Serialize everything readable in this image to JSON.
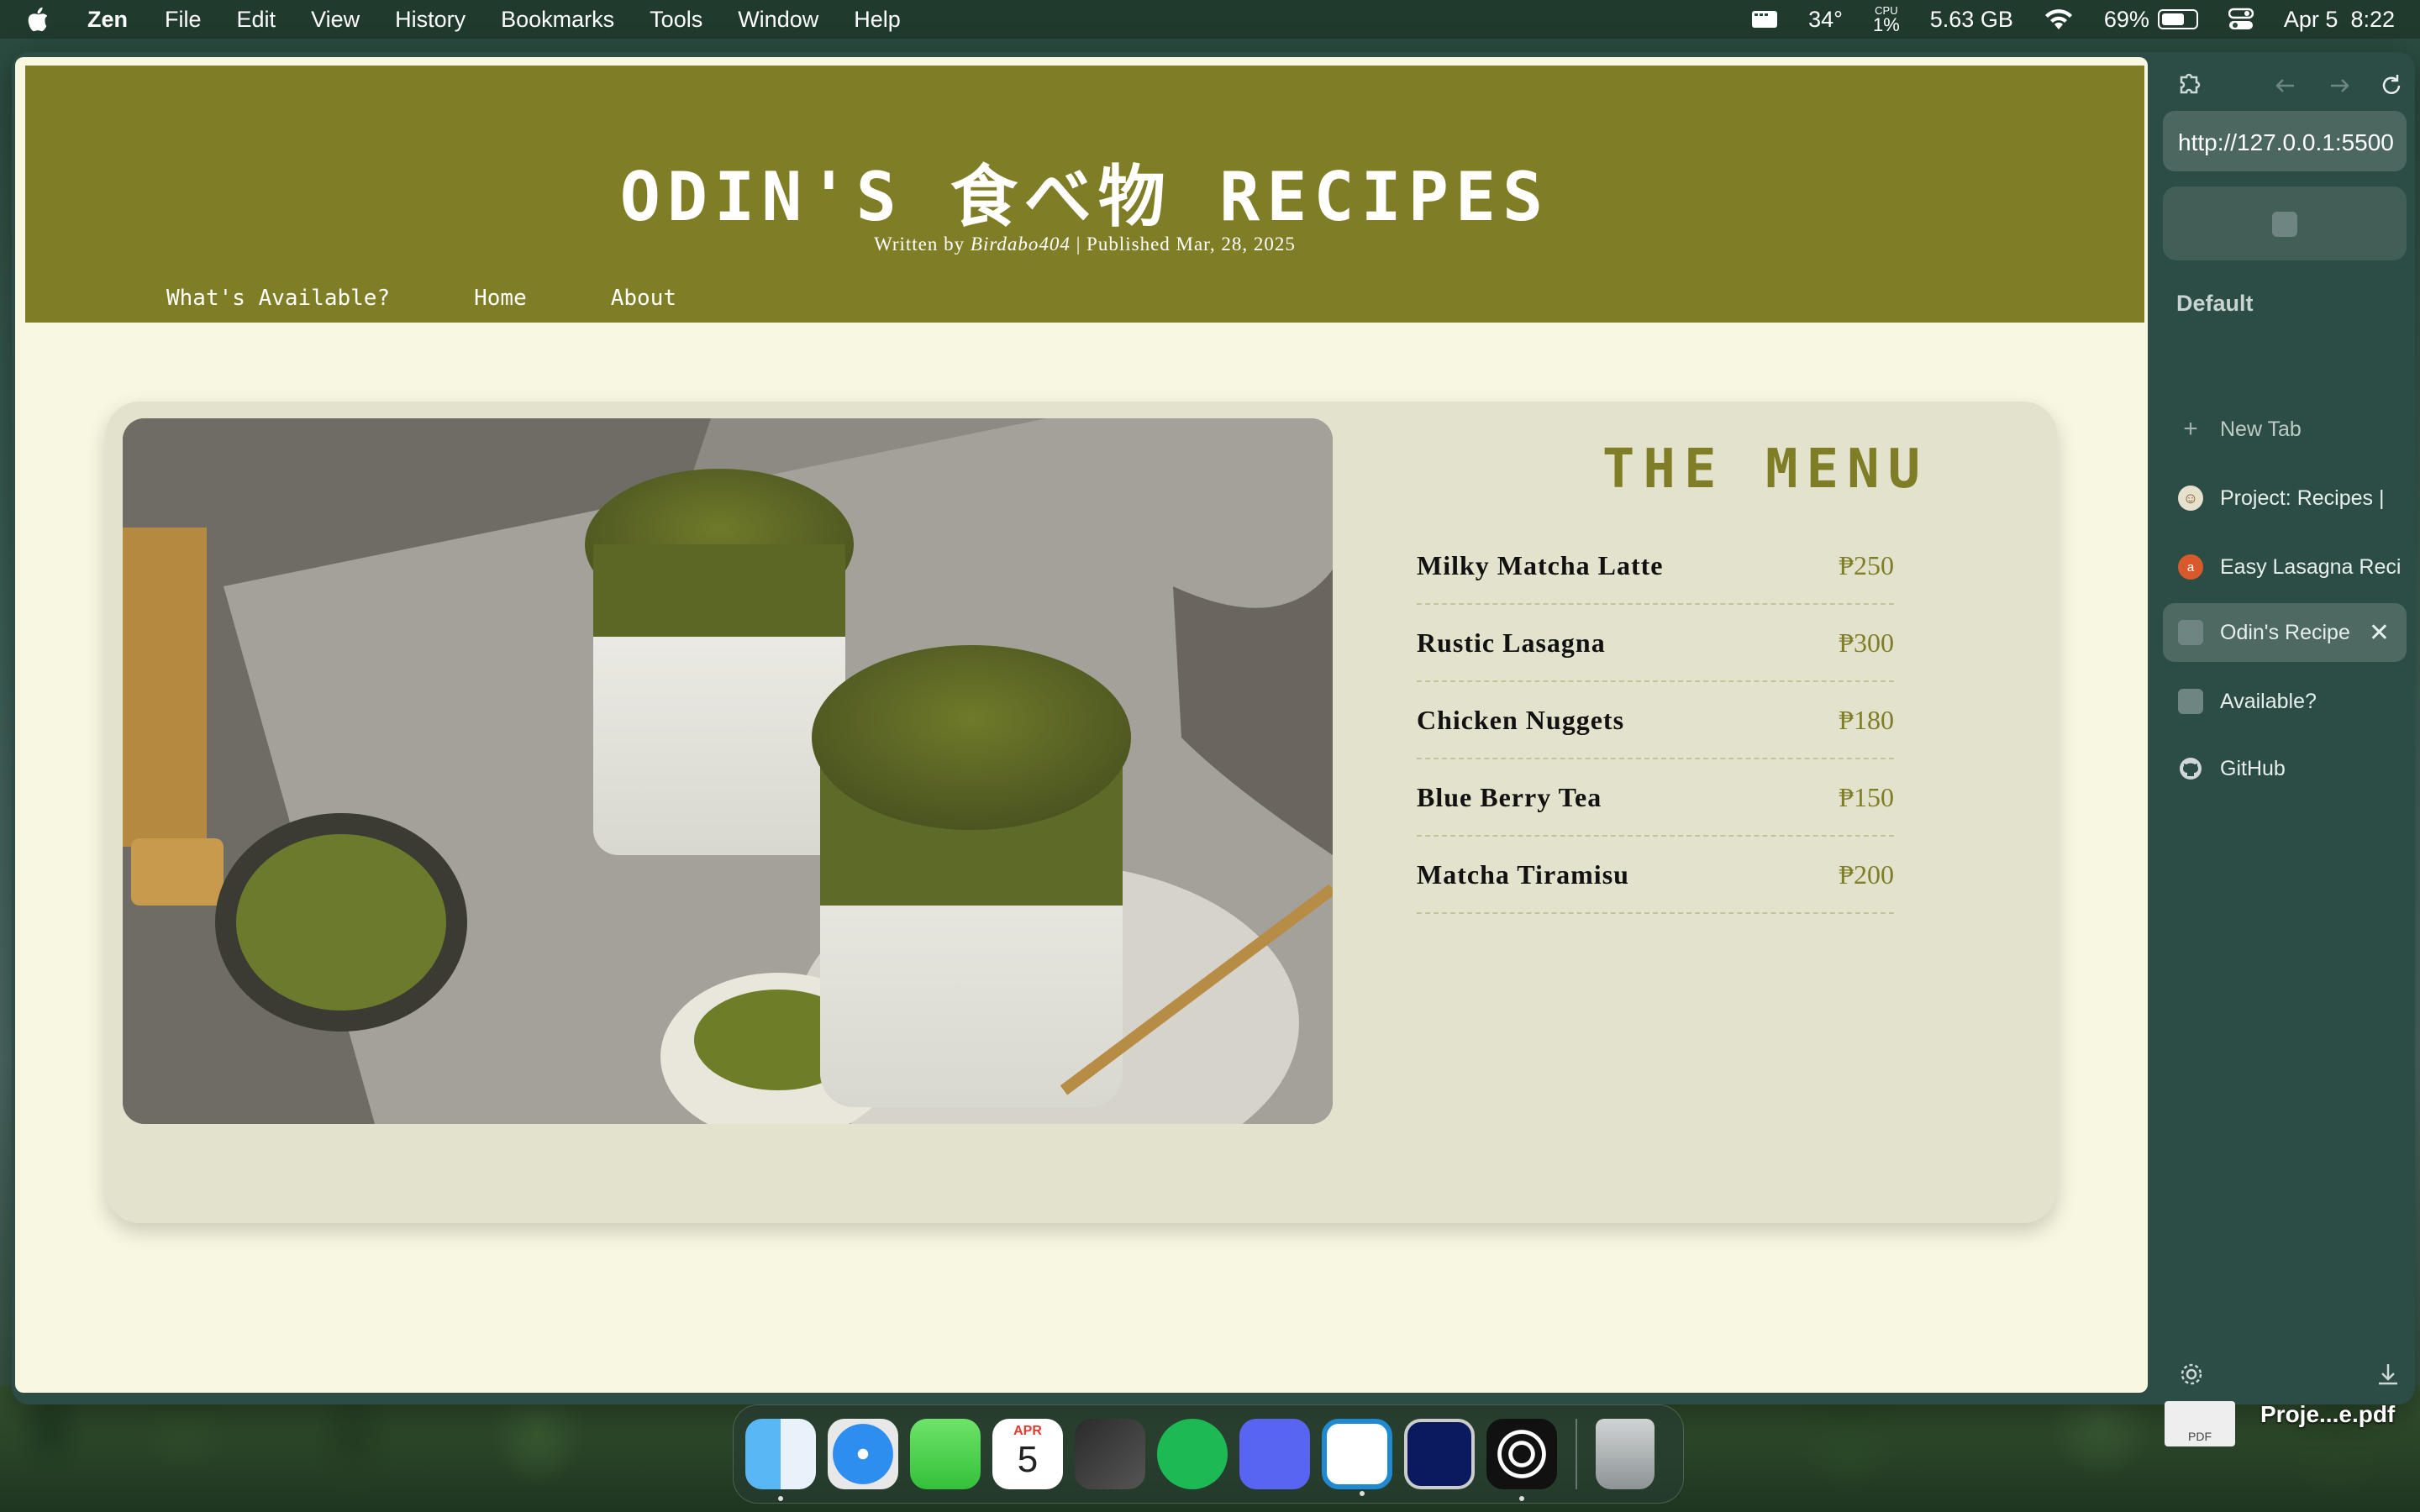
{
  "menubar": {
    "app": "Zen",
    "items": [
      "File",
      "Edit",
      "View",
      "History",
      "Bookmarks",
      "Tools",
      "Window",
      "Help"
    ],
    "temp": "34°",
    "cpu_label": "CPU",
    "cpu_value": "1%",
    "memory": "5.63 GB",
    "battery": "69%",
    "battery_level": 0.69,
    "date": "Apr 5",
    "time": "8:22"
  },
  "site": {
    "title": "ODIN'S 食べ物 RECIPES",
    "byline_prefix": "Written by",
    "author": "Birdabo404",
    "byline_suffix": "| Published Mar, 28, 2025",
    "nav": [
      "What's Available?",
      "Home",
      "About"
    ]
  },
  "menu": {
    "title": "THE MENU",
    "items": [
      {
        "name": "Milky Matcha Latte",
        "price": "₱250"
      },
      {
        "name": "Rustic Lasagna",
        "price": "₱300"
      },
      {
        "name": "Chicken Nuggets",
        "price": "₱180"
      },
      {
        "name": "Blue Berry Tea",
        "price": "₱150"
      },
      {
        "name": "Matcha Tiramisu",
        "price": "₱200"
      }
    ]
  },
  "sidebar": {
    "url": "http://127.0.0.1:5500",
    "workspace": "Default",
    "new_tab": "New Tab",
    "tabs": [
      {
        "label": "Project: Recipes |"
      },
      {
        "label": "Easy Lasagna Reci"
      },
      {
        "label": "Odin's Recipe"
      },
      {
        "label": "Available?"
      },
      {
        "label": "GitHub"
      }
    ]
  },
  "desktop": {
    "file_type": "PDF",
    "file_label": "Proje...e.pdf"
  },
  "dock": {
    "calendar_month": "APR",
    "calendar_day": "5"
  }
}
